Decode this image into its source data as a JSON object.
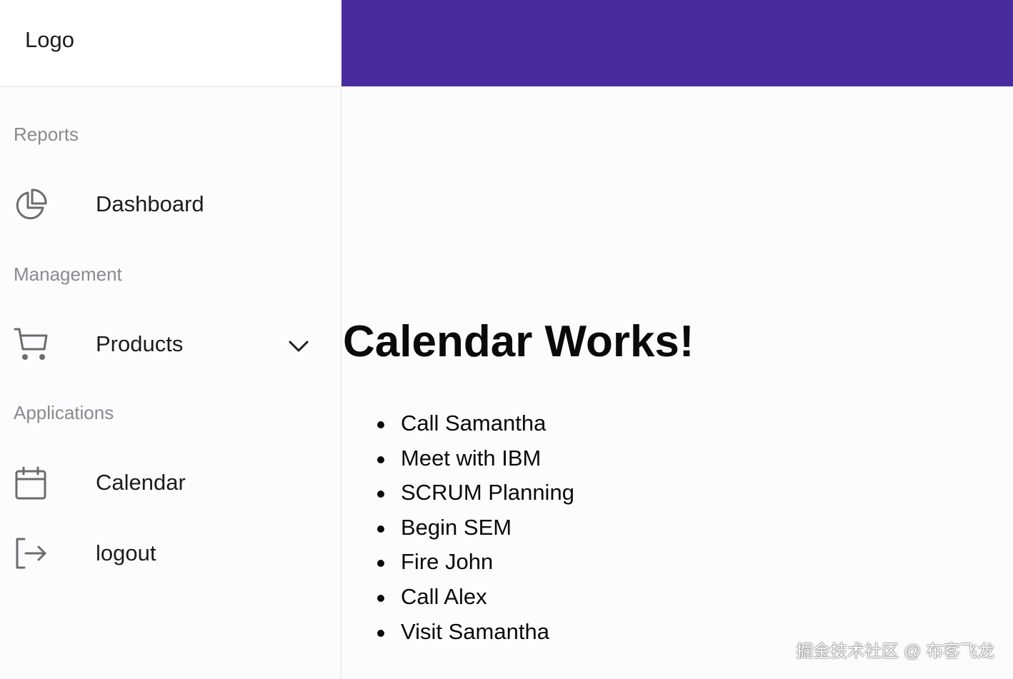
{
  "sidebar": {
    "logo": "Logo",
    "sections": {
      "reports": "Reports",
      "management": "Management",
      "applications": "Applications"
    },
    "items": {
      "dashboard": {
        "label": "Dashboard",
        "icon": "pie-chart-icon"
      },
      "products": {
        "label": "Products",
        "icon": "cart-icon",
        "expand_icon": "chevron-down-icon"
      },
      "calendar": {
        "label": "Calendar",
        "icon": "calendar-icon"
      },
      "logout": {
        "label": "logout",
        "icon": "logout-icon"
      }
    }
  },
  "header": {
    "color": "#482c9e"
  },
  "main": {
    "title": "Calendar Works!",
    "items": [
      "Call Samantha",
      "Meet with IBM",
      "SCRUM Planning",
      "Begin SEM",
      "Fire John",
      "Call Alex",
      "Visit Samantha"
    ]
  },
  "watermark": "掘金技术社区 @ 布客飞龙"
}
